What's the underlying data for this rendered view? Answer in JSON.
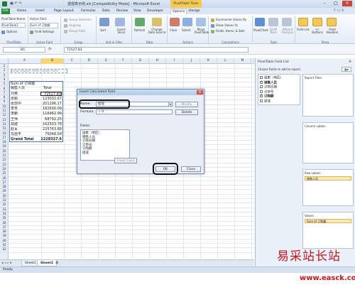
{
  "window": {
    "title": "透视表示例.xls [Compatibility Mode] - Microsoft Excel",
    "context_tab": "PivotTable Tools"
  },
  "tabs": [
    "File",
    "Home",
    "Insert",
    "Page Layout",
    "Formulas",
    "Data",
    "Review",
    "View",
    "Developer",
    "Options",
    "Design"
  ],
  "ribbon": {
    "pivot_name_label": "PivotTable Name:",
    "pivot_name_value": "PivotTable1",
    "options_label": "Options",
    "active_field_label": "Active Field:",
    "active_field_value": "Sum of 订购额",
    "field_settings_label": "Field Settings",
    "group_selection": "Group Selection",
    "ungroup": "Ungroup",
    "group_field": "Group Field",
    "sort_label": "Sort",
    "insert_slicer": "Insert Slicer",
    "refresh": "Refresh",
    "change_data_source": "Change Data Source",
    "clear": "Clear",
    "select": "Select",
    "move_pivottable": "Move PivotTable",
    "summarize_values_by": "Summarize Values By",
    "show_values_as": "Show Values As",
    "fields_items_sets": "Fields, Items, & Sets",
    "pivotchart": "PivotChart",
    "olap_tools": "OLAP Tools",
    "what_if": "What-If Analysis",
    "field_list": "Field List",
    "buttons": "+/- Buttons",
    "field_headers": "Field Headers",
    "groups": [
      "PivotTable",
      "Active Field",
      "Group",
      "Sort & Filter",
      "Data",
      "Actions",
      "Calculations",
      "Tools",
      "Show"
    ]
  },
  "formula_bar": {
    "name_box": "B5",
    "fx": "fx",
    "value": "72527.83"
  },
  "grid": {
    "columns": [
      "A",
      "B",
      "C",
      "D",
      "E",
      "F",
      "G",
      "H",
      "I",
      "J",
      "K",
      "L",
      "M",
      "N"
    ],
    "rows": [
      "1",
      "2",
      "3",
      "4",
      "5",
      "6",
      "7",
      "8",
      "9",
      "10",
      "11",
      "12",
      "13",
      "14",
      "15",
      "16",
      "17",
      "18",
      "19",
      "20",
      "21",
      "22",
      "23",
      "24",
      "25",
      "26",
      "27",
      "28",
      "29",
      "30",
      "31",
      "32",
      "33",
      "34",
      "35",
      "36",
      "37",
      "38",
      "39",
      "40",
      "41",
      "42"
    ],
    "drop_text": "Drop Report Filter Fields Here",
    "pivot_header_value": "Sum of 订购额",
    "pivot_header_row": "销售人员",
    "pivot_header_total": "Total",
    "pivot_rows": [
      {
        "name": "刘英",
        "value": "72527.83"
      },
      {
        "name": "张颖",
        "value": "123032.67"
      },
      {
        "name": "张自中",
        "value": "201196.27"
      },
      {
        "name": "李芳",
        "value": "182500.09"
      },
      {
        "name": "李鹏",
        "value": "116962.99"
      },
      {
        "name": "王伟",
        "value": "68792.25"
      },
      {
        "name": "郑建",
        "value": "162503.78"
      },
      {
        "name": "赵军",
        "value": "225763.68"
      },
      {
        "name": "马自平",
        "value": "75048.04"
      }
    ],
    "grand_total_label": "Grand Total",
    "grand_total_value": "1228327.6"
  },
  "sheets": [
    "Sheet1",
    "Sheet2"
  ],
  "active_sheet": "Sheet2",
  "status": "Ready",
  "field_list": {
    "title": "PivotTable Field List",
    "choose_label": "Choose fields to add to report:",
    "fields": [
      {
        "name": "国家（地区）",
        "checked": false
      },
      {
        "name": "销售人员",
        "checked": true
      },
      {
        "name": "订购日期",
        "checked": false
      },
      {
        "name": "订单号",
        "checked": false
      },
      {
        "name": "订购额",
        "checked": true
      },
      {
        "name": "提成",
        "checked": false
      }
    ],
    "drag_label": "Drag fields between areas below:",
    "report_filter": "Report Filter",
    "column_labels": "Column Labels",
    "row_labels": "Row Labels",
    "row_pill": "销售人员",
    "values": "Values",
    "values_pill": "Sum of 订购额",
    "defer_label": "Defer Layout Update",
    "update": "Update"
  },
  "dialog": {
    "title": "Insert Calculated Field",
    "name_label": "Name:",
    "name_value": "提成",
    "formula_label": "Formula:",
    "formula_value": "= 0",
    "add_button": "Modify",
    "delete_button": "Delete",
    "fields_label": "Fields:",
    "fields": [
      "国家（地区）",
      "销售人员",
      "订购日期",
      "订单号",
      "订购额",
      "提成"
    ],
    "insert_field_button": "Insert Field",
    "ok_button": "OK",
    "close_button": "Close"
  },
  "watermark": {
    "cn": "易采站长站",
    "url": "www.easck.com"
  },
  "colors": {
    "file_tab": "#2a8b3a",
    "context_tab": "#f6c954",
    "pivot_border": "#4a73b8",
    "watermark": "#c8141e"
  }
}
